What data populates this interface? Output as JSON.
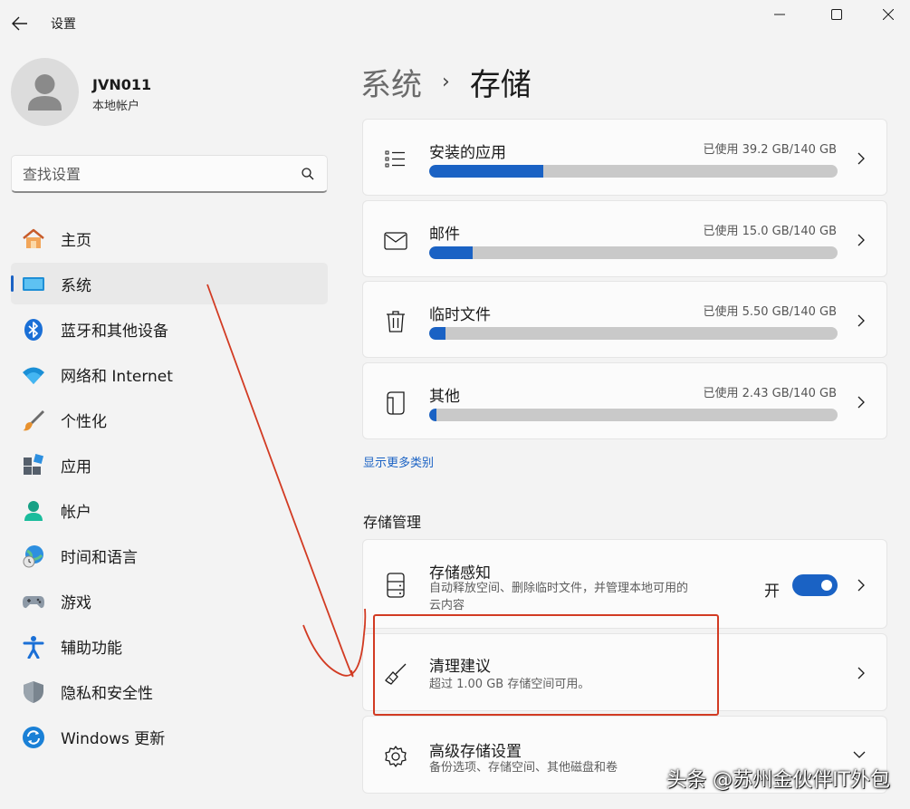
{
  "window": {
    "title": "设置",
    "buttons": {
      "minimize": "minimize",
      "maximize": "maximize",
      "close": "close"
    }
  },
  "user": {
    "name": "JVN011",
    "account_type": "本地帐户"
  },
  "search": {
    "placeholder": "查找设置"
  },
  "sidebar": {
    "items": [
      {
        "label": "主页",
        "icon": "home-icon",
        "active": false
      },
      {
        "label": "系统",
        "icon": "system-icon",
        "active": true
      },
      {
        "label": "蓝牙和其他设备",
        "icon": "bluetooth-icon",
        "active": false
      },
      {
        "label": "网络和 Internet",
        "icon": "wifi-icon",
        "active": false
      },
      {
        "label": "个性化",
        "icon": "brush-icon",
        "active": false
      },
      {
        "label": "应用",
        "icon": "apps-icon",
        "active": false
      },
      {
        "label": "帐户",
        "icon": "account-icon",
        "active": false
      },
      {
        "label": "时间和语言",
        "icon": "globe-clock-icon",
        "active": false
      },
      {
        "label": "游戏",
        "icon": "gamepad-icon",
        "active": false
      },
      {
        "label": "辅助功能",
        "icon": "accessibility-icon",
        "active": false
      },
      {
        "label": "隐私和安全性",
        "icon": "shield-icon",
        "active": false
      },
      {
        "label": "Windows 更新",
        "icon": "update-icon",
        "active": false
      }
    ]
  },
  "breadcrumb": {
    "parent": "系统",
    "separator": "›",
    "current": "存储"
  },
  "usage": [
    {
      "label": "安装的应用",
      "amount": "已使用 39.2 GB/140 GB",
      "used": 39.2,
      "total": 140,
      "icon": "list-icon"
    },
    {
      "label": "邮件",
      "amount": "已使用 15.0 GB/140 GB",
      "used": 15.0,
      "total": 140,
      "icon": "mail-icon"
    },
    {
      "label": "临时文件",
      "amount": "已使用 5.50 GB/140 GB",
      "used": 5.5,
      "total": 140,
      "icon": "trash-icon"
    },
    {
      "label": "其他",
      "amount": "已使用 2.43 GB/140 GB",
      "used": 2.43,
      "total": 140,
      "icon": "document-icon"
    }
  ],
  "show_more": "显示更多类别",
  "management": {
    "title": "存储管理",
    "storage_sense": {
      "title": "存储感知",
      "desc_line1": "自动释放空间、删除临时文件，并管理本地可用的",
      "desc_line2": "云内容",
      "toggle_label": "开",
      "toggle_on": true
    },
    "cleanup": {
      "title": "清理建议",
      "desc": "超过 1.00 GB 存储空间可用。"
    },
    "advanced": {
      "title": "高级存储设置",
      "desc": "备份选项、存储空间、其他磁盘和卷"
    }
  },
  "watermark": "头条 @苏州金伙伴IT外包",
  "colors": {
    "accent": "#1a62c4",
    "annotation": "#d23b23",
    "background": "#f3f3f3",
    "card": "#fbfbfb"
  }
}
